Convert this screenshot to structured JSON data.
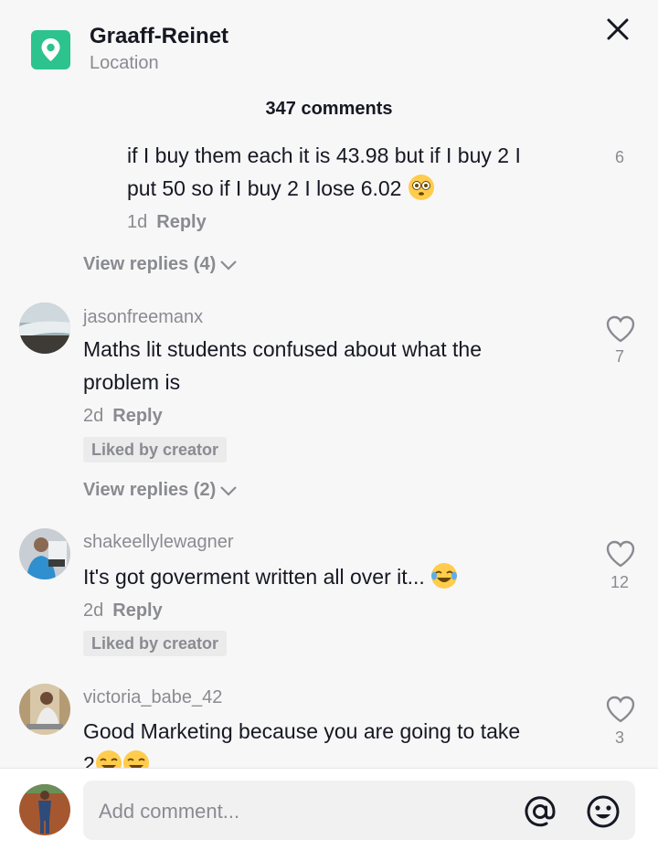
{
  "header": {
    "location_title": "Graaff-Reinet",
    "location_subtitle": "Location",
    "comment_count": "347 comments"
  },
  "comments": [
    {
      "text_line1": "if I buy them each it is 43.98 but if I buy 2 I",
      "text_line2": "put 50 so if I buy 2 I lose 6.02",
      "emoji": "flushed-face",
      "time": "1d",
      "reply": "Reply",
      "likes": "6",
      "view_replies": "View replies (4)"
    },
    {
      "username": "jasonfreemanx",
      "text_line1": "Maths lit students confused about what the",
      "text_line2": "problem is",
      "time": "2d",
      "reply": "Reply",
      "liked_by_creator": "Liked by creator",
      "likes": "7",
      "view_replies": "View replies (2)"
    },
    {
      "username": "shakeellylewagner",
      "text": "It's got goverment written all over it...",
      "emoji": "tears-of-joy",
      "time": "2d",
      "reply": "Reply",
      "liked_by_creator": "Liked by creator",
      "likes": "12"
    },
    {
      "username": "victoria_babe_42",
      "text_line1": "Good Marketing because you are going to take",
      "text_line2_prefix": "2",
      "emoji": "tears-of-joy",
      "likes": "3"
    }
  ],
  "footer": {
    "placeholder": "Add comment...",
    "mention_icon": "at-icon",
    "emoji_icon": "emoji-icon"
  },
  "colors": {
    "accent_location": "#2cc38e",
    "muted_text": "#8a8b91",
    "background": "#f7f7f7"
  }
}
